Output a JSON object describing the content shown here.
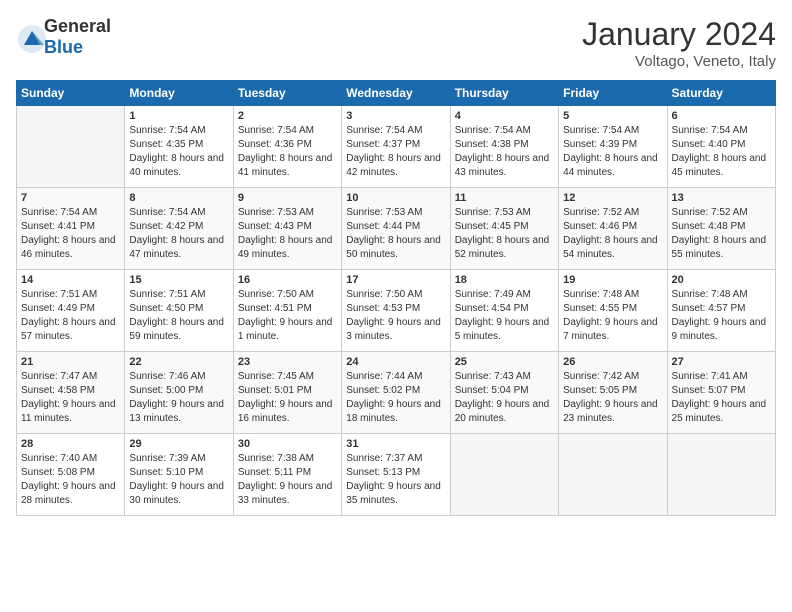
{
  "header": {
    "logo_general": "General",
    "logo_blue": "Blue",
    "month": "January 2024",
    "location": "Voltago, Veneto, Italy"
  },
  "weekdays": [
    "Sunday",
    "Monday",
    "Tuesday",
    "Wednesday",
    "Thursday",
    "Friday",
    "Saturday"
  ],
  "weeks": [
    [
      {
        "day": "",
        "sunrise": "",
        "sunset": "",
        "daylight": ""
      },
      {
        "day": "1",
        "sunrise": "Sunrise: 7:54 AM",
        "sunset": "Sunset: 4:35 PM",
        "daylight": "Daylight: 8 hours and 40 minutes."
      },
      {
        "day": "2",
        "sunrise": "Sunrise: 7:54 AM",
        "sunset": "Sunset: 4:36 PM",
        "daylight": "Daylight: 8 hours and 41 minutes."
      },
      {
        "day": "3",
        "sunrise": "Sunrise: 7:54 AM",
        "sunset": "Sunset: 4:37 PM",
        "daylight": "Daylight: 8 hours and 42 minutes."
      },
      {
        "day": "4",
        "sunrise": "Sunrise: 7:54 AM",
        "sunset": "Sunset: 4:38 PM",
        "daylight": "Daylight: 8 hours and 43 minutes."
      },
      {
        "day": "5",
        "sunrise": "Sunrise: 7:54 AM",
        "sunset": "Sunset: 4:39 PM",
        "daylight": "Daylight: 8 hours and 44 minutes."
      },
      {
        "day": "6",
        "sunrise": "Sunrise: 7:54 AM",
        "sunset": "Sunset: 4:40 PM",
        "daylight": "Daylight: 8 hours and 45 minutes."
      }
    ],
    [
      {
        "day": "7",
        "sunrise": "Sunrise: 7:54 AM",
        "sunset": "Sunset: 4:41 PM",
        "daylight": "Daylight: 8 hours and 46 minutes."
      },
      {
        "day": "8",
        "sunrise": "Sunrise: 7:54 AM",
        "sunset": "Sunset: 4:42 PM",
        "daylight": "Daylight: 8 hours and 47 minutes."
      },
      {
        "day": "9",
        "sunrise": "Sunrise: 7:53 AM",
        "sunset": "Sunset: 4:43 PM",
        "daylight": "Daylight: 8 hours and 49 minutes."
      },
      {
        "day": "10",
        "sunrise": "Sunrise: 7:53 AM",
        "sunset": "Sunset: 4:44 PM",
        "daylight": "Daylight: 8 hours and 50 minutes."
      },
      {
        "day": "11",
        "sunrise": "Sunrise: 7:53 AM",
        "sunset": "Sunset: 4:45 PM",
        "daylight": "Daylight: 8 hours and 52 minutes."
      },
      {
        "day": "12",
        "sunrise": "Sunrise: 7:52 AM",
        "sunset": "Sunset: 4:46 PM",
        "daylight": "Daylight: 8 hours and 54 minutes."
      },
      {
        "day": "13",
        "sunrise": "Sunrise: 7:52 AM",
        "sunset": "Sunset: 4:48 PM",
        "daylight": "Daylight: 8 hours and 55 minutes."
      }
    ],
    [
      {
        "day": "14",
        "sunrise": "Sunrise: 7:51 AM",
        "sunset": "Sunset: 4:49 PM",
        "daylight": "Daylight: 8 hours and 57 minutes."
      },
      {
        "day": "15",
        "sunrise": "Sunrise: 7:51 AM",
        "sunset": "Sunset: 4:50 PM",
        "daylight": "Daylight: 8 hours and 59 minutes."
      },
      {
        "day": "16",
        "sunrise": "Sunrise: 7:50 AM",
        "sunset": "Sunset: 4:51 PM",
        "daylight": "Daylight: 9 hours and 1 minute."
      },
      {
        "day": "17",
        "sunrise": "Sunrise: 7:50 AM",
        "sunset": "Sunset: 4:53 PM",
        "daylight": "Daylight: 9 hours and 3 minutes."
      },
      {
        "day": "18",
        "sunrise": "Sunrise: 7:49 AM",
        "sunset": "Sunset: 4:54 PM",
        "daylight": "Daylight: 9 hours and 5 minutes."
      },
      {
        "day": "19",
        "sunrise": "Sunrise: 7:48 AM",
        "sunset": "Sunset: 4:55 PM",
        "daylight": "Daylight: 9 hours and 7 minutes."
      },
      {
        "day": "20",
        "sunrise": "Sunrise: 7:48 AM",
        "sunset": "Sunset: 4:57 PM",
        "daylight": "Daylight: 9 hours and 9 minutes."
      }
    ],
    [
      {
        "day": "21",
        "sunrise": "Sunrise: 7:47 AM",
        "sunset": "Sunset: 4:58 PM",
        "daylight": "Daylight: 9 hours and 11 minutes."
      },
      {
        "day": "22",
        "sunrise": "Sunrise: 7:46 AM",
        "sunset": "Sunset: 5:00 PM",
        "daylight": "Daylight: 9 hours and 13 minutes."
      },
      {
        "day": "23",
        "sunrise": "Sunrise: 7:45 AM",
        "sunset": "Sunset: 5:01 PM",
        "daylight": "Daylight: 9 hours and 16 minutes."
      },
      {
        "day": "24",
        "sunrise": "Sunrise: 7:44 AM",
        "sunset": "Sunset: 5:02 PM",
        "daylight": "Daylight: 9 hours and 18 minutes."
      },
      {
        "day": "25",
        "sunrise": "Sunrise: 7:43 AM",
        "sunset": "Sunset: 5:04 PM",
        "daylight": "Daylight: 9 hours and 20 minutes."
      },
      {
        "day": "26",
        "sunrise": "Sunrise: 7:42 AM",
        "sunset": "Sunset: 5:05 PM",
        "daylight": "Daylight: 9 hours and 23 minutes."
      },
      {
        "day": "27",
        "sunrise": "Sunrise: 7:41 AM",
        "sunset": "Sunset: 5:07 PM",
        "daylight": "Daylight: 9 hours and 25 minutes."
      }
    ],
    [
      {
        "day": "28",
        "sunrise": "Sunrise: 7:40 AM",
        "sunset": "Sunset: 5:08 PM",
        "daylight": "Daylight: 9 hours and 28 minutes."
      },
      {
        "day": "29",
        "sunrise": "Sunrise: 7:39 AM",
        "sunset": "Sunset: 5:10 PM",
        "daylight": "Daylight: 9 hours and 30 minutes."
      },
      {
        "day": "30",
        "sunrise": "Sunrise: 7:38 AM",
        "sunset": "Sunset: 5:11 PM",
        "daylight": "Daylight: 9 hours and 33 minutes."
      },
      {
        "day": "31",
        "sunrise": "Sunrise: 7:37 AM",
        "sunset": "Sunset: 5:13 PM",
        "daylight": "Daylight: 9 hours and 35 minutes."
      },
      {
        "day": "",
        "sunrise": "",
        "sunset": "",
        "daylight": ""
      },
      {
        "day": "",
        "sunrise": "",
        "sunset": "",
        "daylight": ""
      },
      {
        "day": "",
        "sunrise": "",
        "sunset": "",
        "daylight": ""
      }
    ]
  ]
}
